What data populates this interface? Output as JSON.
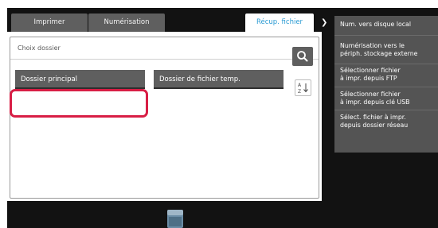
{
  "tabs": [
    {
      "label": "Imprimer"
    },
    {
      "label": "Numérisation"
    },
    {
      "label": "Récup. fichier"
    }
  ],
  "folder_panel": {
    "title": "Choix dossier",
    "folders": [
      {
        "label": "Dossier principal",
        "selected": true
      },
      {
        "label": "Dossier de fichier temp."
      }
    ]
  },
  "sidebar": {
    "items": [
      {
        "line1": "Num. vers disque local",
        "line2": ""
      },
      {
        "line1": "Numérisation vers le",
        "line2": "périph. stockage externe"
      },
      {
        "line1": "Sélectionner fichier",
        "line2": "à impr. depuis FTP"
      },
      {
        "line1": "Sélectionner fichier",
        "line2": "à impr. depuis clé USB"
      },
      {
        "line1": "Sélect. fichier à impr.",
        "line2": "depuis dossier réseau"
      }
    ]
  },
  "icons": {
    "tab_arrow": "chevron-right-icon",
    "search": "search-icon",
    "sort": "sort-az-icon",
    "usb": "usb-storage-icon"
  },
  "colors": {
    "highlight": "#d81e45",
    "active_tab_text": "#2a9bd3",
    "button": "#5f5f5f",
    "sidebar": "#545454"
  }
}
